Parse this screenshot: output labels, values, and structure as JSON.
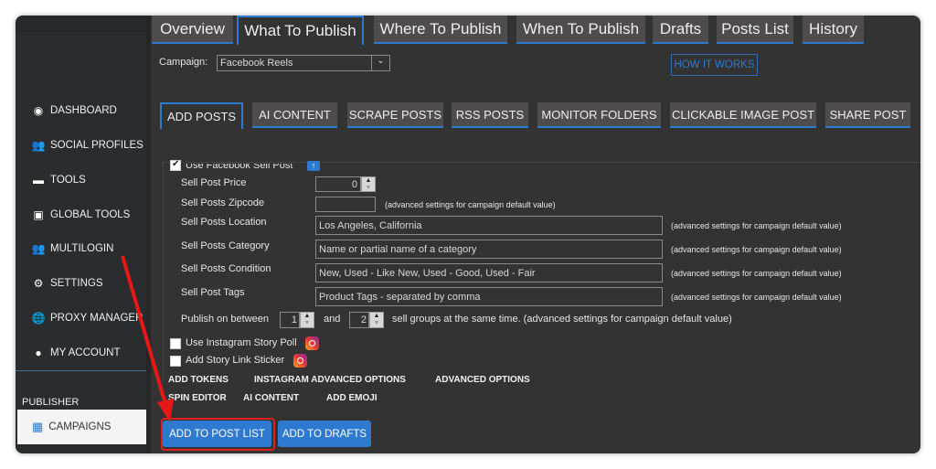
{
  "sidebar": {
    "items": [
      {
        "label": "DASHBOARD",
        "icon": "compass-icon"
      },
      {
        "label": "SOCIAL PROFILES",
        "icon": "users-icon"
      },
      {
        "label": "TOOLS",
        "icon": "toolbox-icon"
      },
      {
        "label": "GLOBAL TOOLS",
        "icon": "globe-toolbox-icon"
      },
      {
        "label": "MULTILOGIN",
        "icon": "users-icon"
      },
      {
        "label": "SETTINGS",
        "icon": "gear-icon"
      },
      {
        "label": "PROXY MANAGER",
        "icon": "globe-icon"
      },
      {
        "label": "MY ACCOUNT",
        "icon": "user-circle-icon"
      }
    ],
    "section": "PUBLISHER",
    "active": "CAMPAIGNS"
  },
  "tabs": [
    "Overview",
    "What To Publish",
    "Where To Publish",
    "When To Publish",
    "Drafts",
    "Posts List",
    "History"
  ],
  "campaign": {
    "label": "Campaign:",
    "value": "Facebook Reels"
  },
  "how_it_works": "HOW IT WORKS",
  "subtabs": [
    "ADD POSTS",
    "AI CONTENT",
    "SCRAPE POSTS",
    "RSS POSTS",
    "MONITOR FOLDERS",
    "CLICKABLE IMAGE POST",
    "SHARE POST"
  ],
  "form": {
    "use_sell_post": "Use Facebook Sell Post",
    "price_label": "Sell Post Price",
    "price": "0",
    "zip_label": "Sell Posts Zipcode",
    "zip": "",
    "location_label": "Sell Posts Location",
    "location": "Los Angeles, California",
    "category_label": "Sell Posts Category",
    "category_placeholder": "Name or partial name of a category",
    "condition_label": "Sell Posts Condition",
    "condition_placeholder": "New, Used - Like New, Used - Good, Used - Fair",
    "tags_label": "Sell Post Tags",
    "tags_placeholder": "Product Tags - separated by comma",
    "note": "(advanced settings for campaign default value)",
    "publish_between": "Publish on between",
    "min": "1",
    "and": "and",
    "max": "2",
    "publish_suffix": "sell groups at the same time. (advanced settings for campaign default value)",
    "story_poll": "Use Instagram Story Poll",
    "story_link": "Add Story Link Sticker"
  },
  "links": [
    "ADD TOKENS",
    "INSTAGRAM ADVANCED OPTIONS",
    "ADVANCED OPTIONS",
    "SPIN EDITOR",
    "AI CONTENT",
    "ADD EMOJI"
  ],
  "buttons": {
    "add_to_post_list": "ADD TO POST LIST",
    "add_to_drafts": "ADD TO DRAFTS"
  },
  "colors": {
    "accent": "#2f7ad1",
    "highlight": "#e02020"
  }
}
